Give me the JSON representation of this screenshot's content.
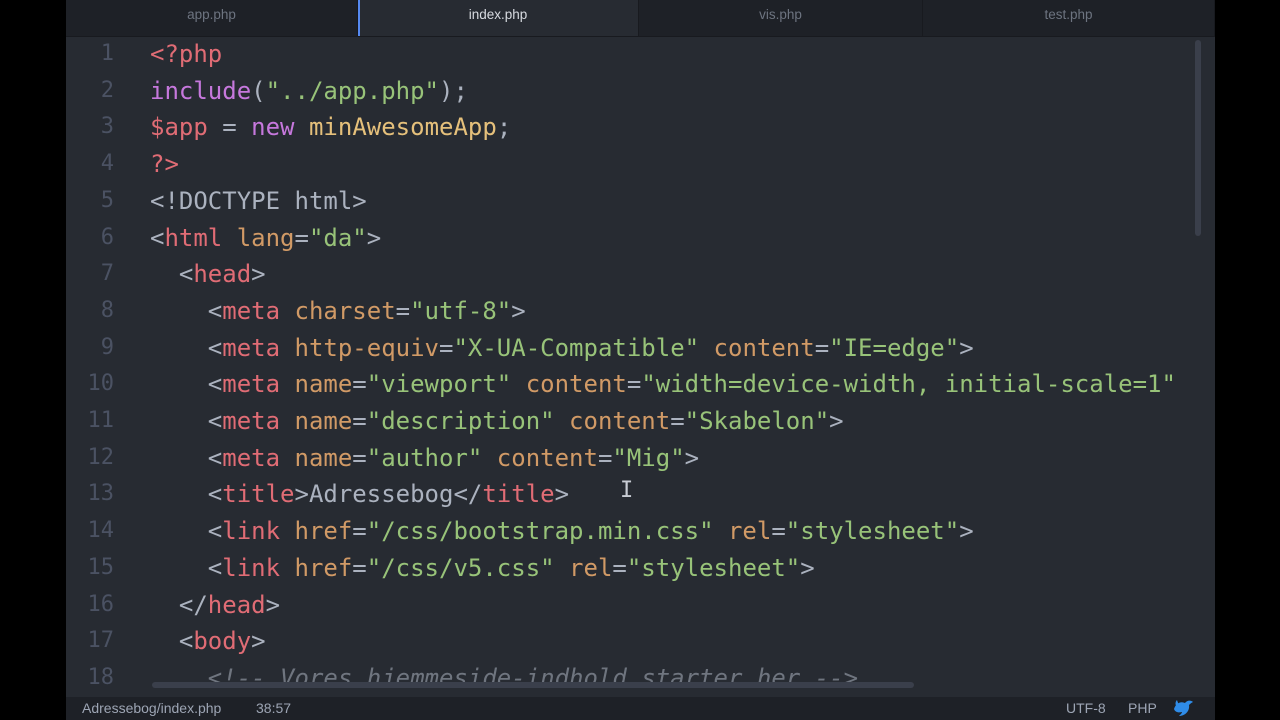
{
  "tabs": [
    {
      "label": "app.php",
      "active": false
    },
    {
      "label": "index.php",
      "active": true
    },
    {
      "label": "vis.php",
      "active": false
    },
    {
      "label": "test.php",
      "active": false
    }
  ],
  "lines": [
    {
      "n": "1",
      "tokens": [
        [
          "tag",
          "<?php"
        ]
      ]
    },
    {
      "n": "2",
      "tokens": [
        [
          "fn",
          "include"
        ],
        [
          "punct",
          "("
        ],
        [
          "str",
          "\"../app.php\""
        ],
        [
          "punct",
          ");"
        ]
      ]
    },
    {
      "n": "3",
      "tokens": [
        [
          "var",
          "$app"
        ],
        [
          "punct",
          " = "
        ],
        [
          "kw",
          "new"
        ],
        [
          "punct",
          " "
        ],
        [
          "cls",
          "minAwesomeApp"
        ],
        [
          "punct",
          ";"
        ]
      ]
    },
    {
      "n": "4",
      "tokens": [
        [
          "tag",
          "?>"
        ]
      ]
    },
    {
      "n": "5",
      "tokens": [
        [
          "punct",
          "<!DOCTYPE html>"
        ]
      ]
    },
    {
      "n": "6",
      "tokens": [
        [
          "punct",
          "<"
        ],
        [
          "tag",
          "html"
        ],
        [
          "punct",
          " "
        ],
        [
          "attr",
          "lang"
        ],
        [
          "punct",
          "="
        ],
        [
          "str",
          "\"da\""
        ],
        [
          "punct",
          ">"
        ]
      ]
    },
    {
      "n": "7",
      "tokens": [
        [
          "punct",
          "  <"
        ],
        [
          "tag",
          "head"
        ],
        [
          "punct",
          ">"
        ]
      ]
    },
    {
      "n": "8",
      "tokens": [
        [
          "punct",
          "    <"
        ],
        [
          "tag",
          "meta"
        ],
        [
          "punct",
          " "
        ],
        [
          "attr",
          "charset"
        ],
        [
          "punct",
          "="
        ],
        [
          "str",
          "\"utf-8\""
        ],
        [
          "punct",
          ">"
        ]
      ]
    },
    {
      "n": "9",
      "tokens": [
        [
          "punct",
          "    <"
        ],
        [
          "tag",
          "meta"
        ],
        [
          "punct",
          " "
        ],
        [
          "attr",
          "http-equiv"
        ],
        [
          "punct",
          "="
        ],
        [
          "str",
          "\"X-UA-Compatible\""
        ],
        [
          "punct",
          " "
        ],
        [
          "attr",
          "content"
        ],
        [
          "punct",
          "="
        ],
        [
          "str",
          "\"IE=edge\""
        ],
        [
          "punct",
          ">"
        ]
      ]
    },
    {
      "n": "10",
      "tokens": [
        [
          "punct",
          "    <"
        ],
        [
          "tag",
          "meta"
        ],
        [
          "punct",
          " "
        ],
        [
          "attr",
          "name"
        ],
        [
          "punct",
          "="
        ],
        [
          "str",
          "\"viewport\""
        ],
        [
          "punct",
          " "
        ],
        [
          "attr",
          "content"
        ],
        [
          "punct",
          "="
        ],
        [
          "str",
          "\"width=device-width, initial-scale=1\""
        ]
      ]
    },
    {
      "n": "11",
      "tokens": [
        [
          "punct",
          "    <"
        ],
        [
          "tag",
          "meta"
        ],
        [
          "punct",
          " "
        ],
        [
          "attr",
          "name"
        ],
        [
          "punct",
          "="
        ],
        [
          "str",
          "\"description\""
        ],
        [
          "punct",
          " "
        ],
        [
          "attr",
          "content"
        ],
        [
          "punct",
          "="
        ],
        [
          "str",
          "\"Skabelon\""
        ],
        [
          "punct",
          ">"
        ]
      ]
    },
    {
      "n": "12",
      "tokens": [
        [
          "punct",
          "    <"
        ],
        [
          "tag",
          "meta"
        ],
        [
          "punct",
          " "
        ],
        [
          "attr",
          "name"
        ],
        [
          "punct",
          "="
        ],
        [
          "str",
          "\"author\""
        ],
        [
          "punct",
          " "
        ],
        [
          "attr",
          "content"
        ],
        [
          "punct",
          "="
        ],
        [
          "str",
          "\"Mig\""
        ],
        [
          "punct",
          ">"
        ]
      ]
    },
    {
      "n": "13",
      "tokens": [
        [
          "punct",
          "    <"
        ],
        [
          "tag",
          "title"
        ],
        [
          "punct",
          ">Adressebog</"
        ],
        [
          "tag",
          "title"
        ],
        [
          "punct",
          ">"
        ]
      ]
    },
    {
      "n": "14",
      "tokens": [
        [
          "punct",
          "    <"
        ],
        [
          "tag",
          "link"
        ],
        [
          "punct",
          " "
        ],
        [
          "attr",
          "href"
        ],
        [
          "punct",
          "="
        ],
        [
          "str",
          "\"/css/bootstrap.min.css\""
        ],
        [
          "punct",
          " "
        ],
        [
          "attr",
          "rel"
        ],
        [
          "punct",
          "="
        ],
        [
          "str",
          "\"stylesheet\""
        ],
        [
          "punct",
          ">"
        ]
      ]
    },
    {
      "n": "15",
      "tokens": [
        [
          "punct",
          "    <"
        ],
        [
          "tag",
          "link"
        ],
        [
          "punct",
          " "
        ],
        [
          "attr",
          "href"
        ],
        [
          "punct",
          "="
        ],
        [
          "str",
          "\"/css/v5.css\""
        ],
        [
          "punct",
          " "
        ],
        [
          "attr",
          "rel"
        ],
        [
          "punct",
          "="
        ],
        [
          "str",
          "\"stylesheet\""
        ],
        [
          "punct",
          ">"
        ]
      ]
    },
    {
      "n": "16",
      "tokens": [
        [
          "punct",
          "  </"
        ],
        [
          "tag",
          "head"
        ],
        [
          "punct",
          ">"
        ]
      ]
    },
    {
      "n": "17",
      "tokens": [
        [
          "punct",
          "  <"
        ],
        [
          "tag",
          "body"
        ],
        [
          "punct",
          ">"
        ]
      ]
    },
    {
      "n": "18",
      "comment": true,
      "tokens": [
        [
          "punct",
          "    <!-- Vores hjemmeside-indhold starter her -->"
        ]
      ]
    }
  ],
  "status": {
    "path": "Adressebog/index.php",
    "position": "38:57",
    "encoding": "UTF-8",
    "grammar": "PHP"
  },
  "colors": {
    "background": "#272b32",
    "tag": "#e06c75",
    "attribute": "#d19a66",
    "string": "#98c379",
    "keyword": "#c678dd",
    "class": "#e5c07b",
    "accent": "#568af2"
  },
  "icons": {
    "status_bird": "bird-icon",
    "cursor": "text-cursor-icon"
  }
}
